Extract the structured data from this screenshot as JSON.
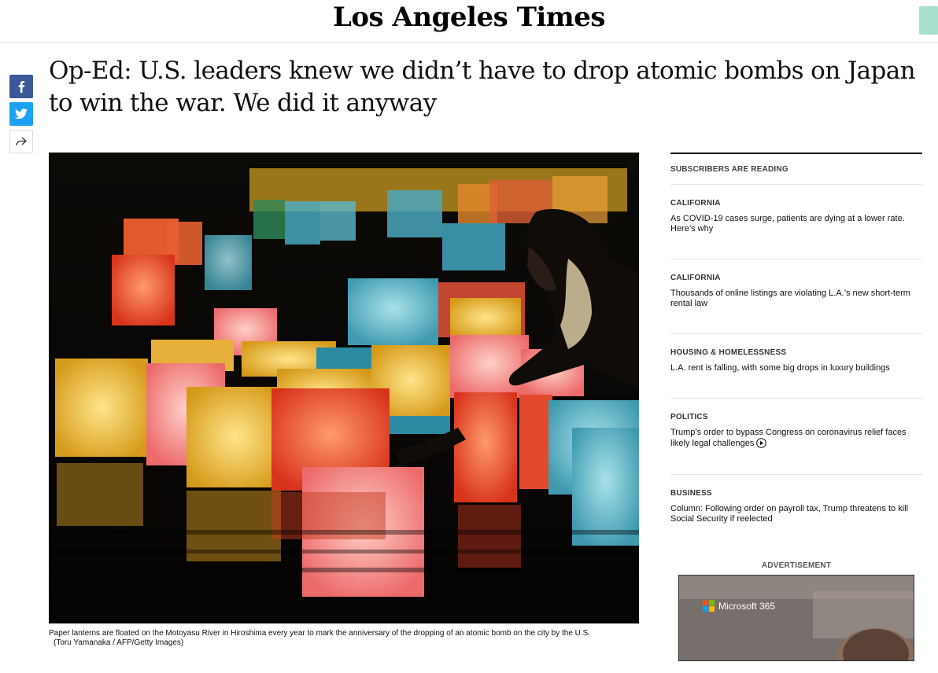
{
  "masthead": {
    "logo": "Los Angeles Times"
  },
  "share": {
    "facebook_icon": "facebook-icon",
    "twitter_icon": "twitter-icon",
    "share_icon": "share-arrow-icon"
  },
  "article": {
    "headline": "Op-Ed: U.S. leaders knew we didn’t have to drop atomic bombs on Japan to win the war. We did it anyway",
    "caption": "Paper lanterns are floated on the Motoyasu River in Hiroshima every year to mark the anniversary of the dropping of an atomic bomb on the city by the U.S.",
    "credit": "(Toru Yamanaka / AFP/Getty Images)"
  },
  "sidebar": {
    "heading": "SUBSCRIBERS ARE READING",
    "items": [
      {
        "section": "CALIFORNIA",
        "title": "As COVID-19 cases surge, patients are dying at a lower rate. Here’s why",
        "has_video": false
      },
      {
        "section": "CALIFORNIA",
        "title": "Thousands of online listings are violating L.A.’s new short-term rental law",
        "has_video": false
      },
      {
        "section": "HOUSING & HOMELESSNESS",
        "title": "L.A. rent is falling, with some big drops in luxury buildings",
        "has_video": false
      },
      {
        "section": "POLITICS",
        "title": "Trump’s order to bypass Congress on coronavirus relief faces likely legal challenges",
        "has_video": true
      },
      {
        "section": "BUSINESS",
        "title": "Column: Following order on payroll tax, Trump threatens to kill Social Security if reelected",
        "has_video": false
      }
    ]
  },
  "ad": {
    "label": "ADVERTISEMENT",
    "brand": "Microsoft 365"
  },
  "colors": {
    "facebook": "#3b5998",
    "twitter": "#1da1f2",
    "accent_button": "#a9dfcf"
  }
}
